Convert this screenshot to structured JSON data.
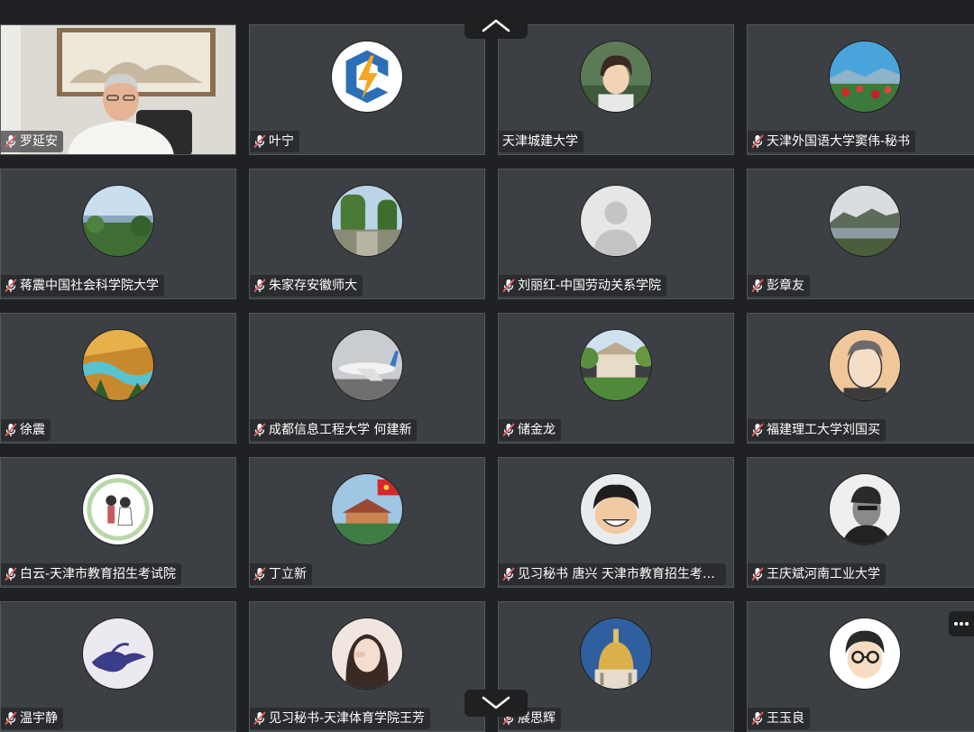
{
  "participants": [
    {
      "name": "罗延安",
      "muted": true,
      "kind": "video"
    },
    {
      "name": "叶宁",
      "muted": true,
      "kind": "logo-bolt"
    },
    {
      "name": "天津城建大学",
      "muted": false,
      "kind": "anime-boy"
    },
    {
      "name": "天津外国语大学窦伟-秘书",
      "muted": true,
      "kind": "landscape-flowers"
    },
    {
      "name": "蒋震中国社会科学院大学",
      "muted": true,
      "kind": "landscape-valley"
    },
    {
      "name": "朱家存安徽师大",
      "muted": true,
      "kind": "landscape-park"
    },
    {
      "name": "刘丽红-中国劳动关系学院",
      "muted": true,
      "kind": "default-person"
    },
    {
      "name": "彭章友",
      "muted": true,
      "kind": "landscape-lake"
    },
    {
      "name": "徐震",
      "muted": true,
      "kind": "landscape-river"
    },
    {
      "name": "成都信息工程大学  何建新",
      "muted": true,
      "kind": "airplane"
    },
    {
      "name": "储金龙",
      "muted": true,
      "kind": "building"
    },
    {
      "name": "福建理工大学刘国买",
      "muted": true,
      "kind": "portrait-sketch"
    },
    {
      "name": "白云-天津市教育招生考试院",
      "muted": true,
      "kind": "couple-drawing"
    },
    {
      "name": "丁立新",
      "muted": true,
      "kind": "pagoda-flag"
    },
    {
      "name": "见习秘书 唐兴 天津市教育招生考试院",
      "muted": true,
      "kind": "cartoon-smile"
    },
    {
      "name": "王庆斌河南工业大学",
      "muted": true,
      "kind": "bw-portrait"
    },
    {
      "name": "温宇静",
      "muted": true,
      "kind": "ink-bird"
    },
    {
      "name": "见习秘书-天津体育学院王芳",
      "muted": true,
      "kind": "girl-photo"
    },
    {
      "name": "展思辉",
      "muted": true,
      "kind": "dome"
    },
    {
      "name": "王玉良",
      "muted": true,
      "kind": "cartoon-glasses"
    }
  ],
  "controls": {
    "prev_page_icon": "chevron-up-icon",
    "next_page_icon": "chevron-down-icon",
    "more_icon": "more-horizontal-icon"
  },
  "colors": {
    "background": "#202124",
    "tile": "#3c3f43",
    "tile_border": "#53575c",
    "mic_muted": "#e06060"
  }
}
